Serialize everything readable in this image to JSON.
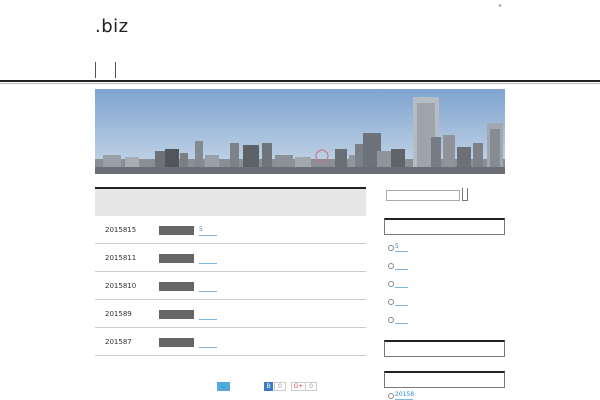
{
  "header": {
    "site_title": ".biz",
    "tiny_mark": "▸"
  },
  "hero": {
    "image": "city-skyline"
  },
  "main": {
    "posts": [
      {
        "date": "2015815",
        "link": "5"
      },
      {
        "date": "2015811",
        "link": ""
      },
      {
        "date": "2015810",
        "link": ""
      },
      {
        "date": "201589",
        "link": ""
      },
      {
        "date": "201587",
        "link": ""
      }
    ]
  },
  "share": {
    "twitter": "🐦",
    "hatena": "B",
    "hatena_count": "0",
    "gplus": "G+",
    "gplus_count": "0"
  },
  "sidebar": {
    "recent_links": [
      "5",
      "",
      "",
      "",
      ""
    ],
    "archive_links": [
      "20158"
    ]
  },
  "colors": {
    "link": "#2a8ad4",
    "category_badge": "#666666",
    "header_line": "#222222",
    "title_bar": "#e7e7e7"
  }
}
